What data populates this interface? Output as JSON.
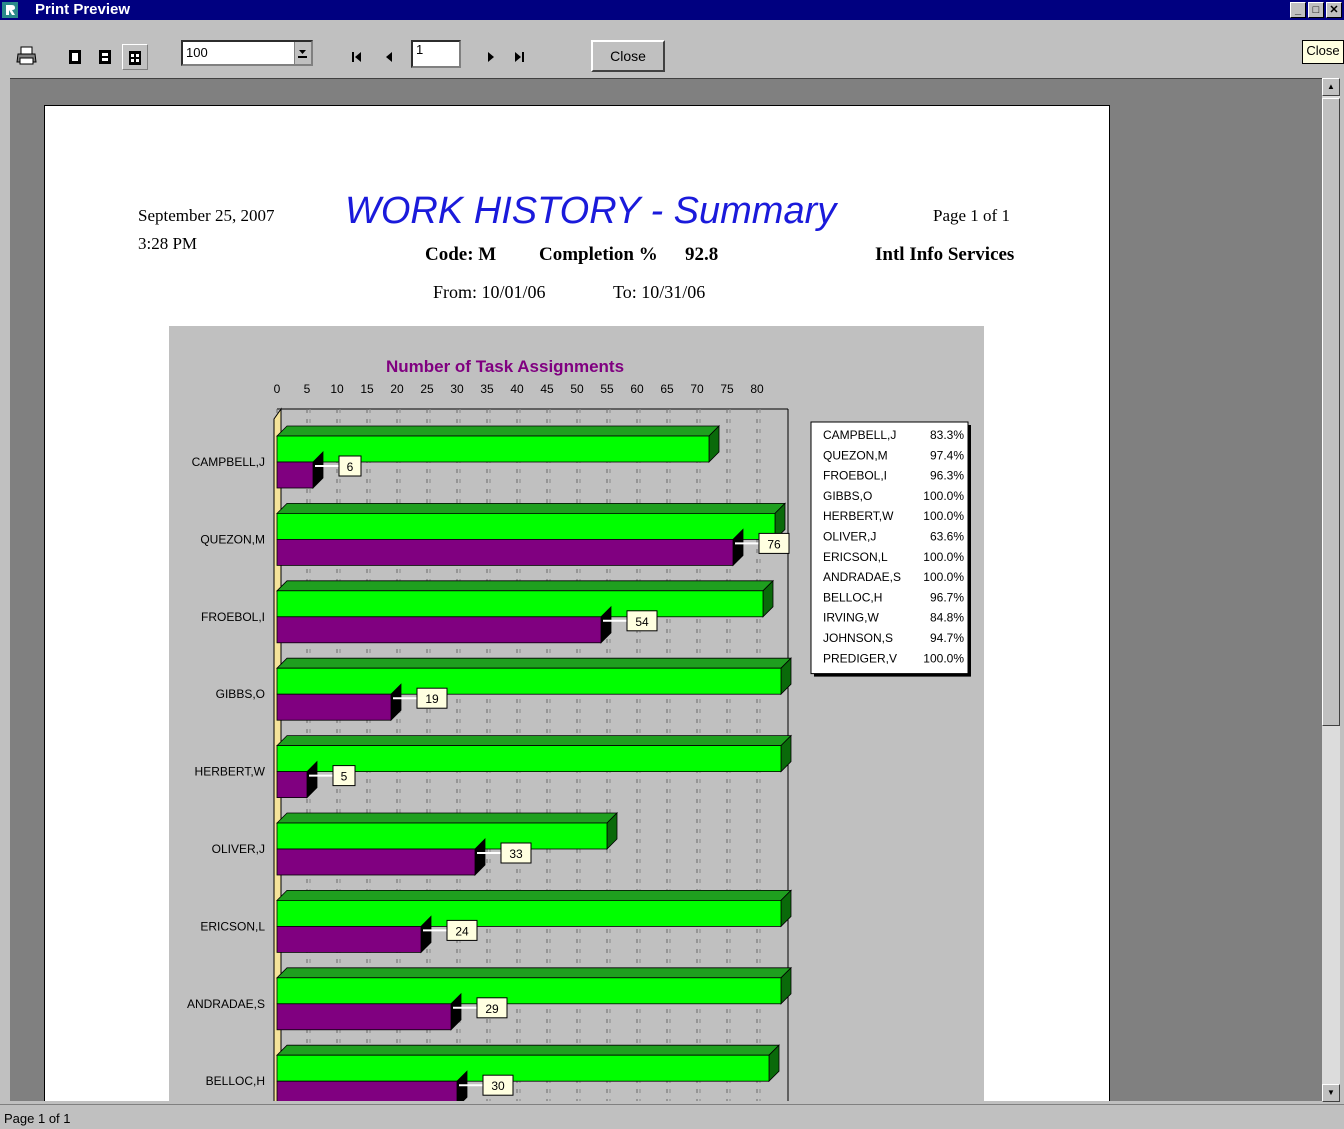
{
  "window": {
    "title": "Print Preview",
    "min": "_",
    "max": "□",
    "close": "✕"
  },
  "toolbar": {
    "zoom_value": "100",
    "page_value": "1",
    "close_label": "Close",
    "tooltip": "Close",
    "icons": [
      "printer-icon",
      "one-page-icon",
      "two-page-icon",
      "multi-page-icon",
      "first-page-icon",
      "prev-page-icon",
      "next-page-icon",
      "last-page-icon"
    ]
  },
  "status": {
    "text": "Page 1 of 1"
  },
  "report": {
    "date": "September 25, 2007",
    "time": "3:28 PM",
    "title": "WORK HISTORY - Summary",
    "page": "Page 1 of 1",
    "code": "Code: M",
    "completion_label": "Completion %",
    "completion_value": "92.8",
    "company": "Intl Info Services",
    "from": "From: 10/01/06",
    "to": "To: 10/31/06"
  },
  "colors": {
    "green": "#00ff00",
    "purple": "#800080",
    "title_blue": "#1a1adb",
    "titlebar": "#000080"
  },
  "chart_data": {
    "type": "bar",
    "orientation": "horizontal-3d",
    "title": "Number of Task Assignments",
    "x_ticks": [
      0,
      5,
      10,
      15,
      20,
      25,
      30,
      35,
      40,
      45,
      50,
      55,
      60,
      65,
      70,
      75,
      80
    ],
    "xlim": [
      0,
      85
    ],
    "grid": true,
    "categories": [
      "CAMPBELL,J",
      "QUEZON,M",
      "FROEBOL,I",
      "GIBBS,O",
      "HERBERT,W",
      "OLIVER,J",
      "ERICSON,L",
      "ANDRADAE,S",
      "BELLOC,H"
    ],
    "series": [
      {
        "values": [
          72,
          83,
          81,
          84,
          84,
          55,
          84,
          84,
          82
        ]
      },
      {
        "values": [
          6,
          76,
          54,
          19,
          5,
          33,
          24,
          29,
          30
        ]
      }
    ],
    "data_labels": [
      "6",
      "76",
      "54",
      "19",
      "5",
      "33",
      "24",
      "29",
      "30"
    ],
    "legend": [
      {
        "name": "CAMPBELL,J",
        "pct": "83.3%"
      },
      {
        "name": "QUEZON,M",
        "pct": "97.4%"
      },
      {
        "name": "FROEBOL,I",
        "pct": "96.3%"
      },
      {
        "name": "GIBBS,O",
        "pct": "100.0%"
      },
      {
        "name": "HERBERT,W",
        "pct": "100.0%"
      },
      {
        "name": "OLIVER,J",
        "pct": "63.6%"
      },
      {
        "name": "ERICSON,L",
        "pct": "100.0%"
      },
      {
        "name": "ANDRADAE,S",
        "pct": "100.0%"
      },
      {
        "name": "BELLOC,H",
        "pct": "96.7%"
      },
      {
        "name": "IRVING,W",
        "pct": "84.8%"
      },
      {
        "name": "JOHNSON,S",
        "pct": "94.7%"
      },
      {
        "name": "PREDIGER,V",
        "pct": "100.0%"
      }
    ]
  }
}
